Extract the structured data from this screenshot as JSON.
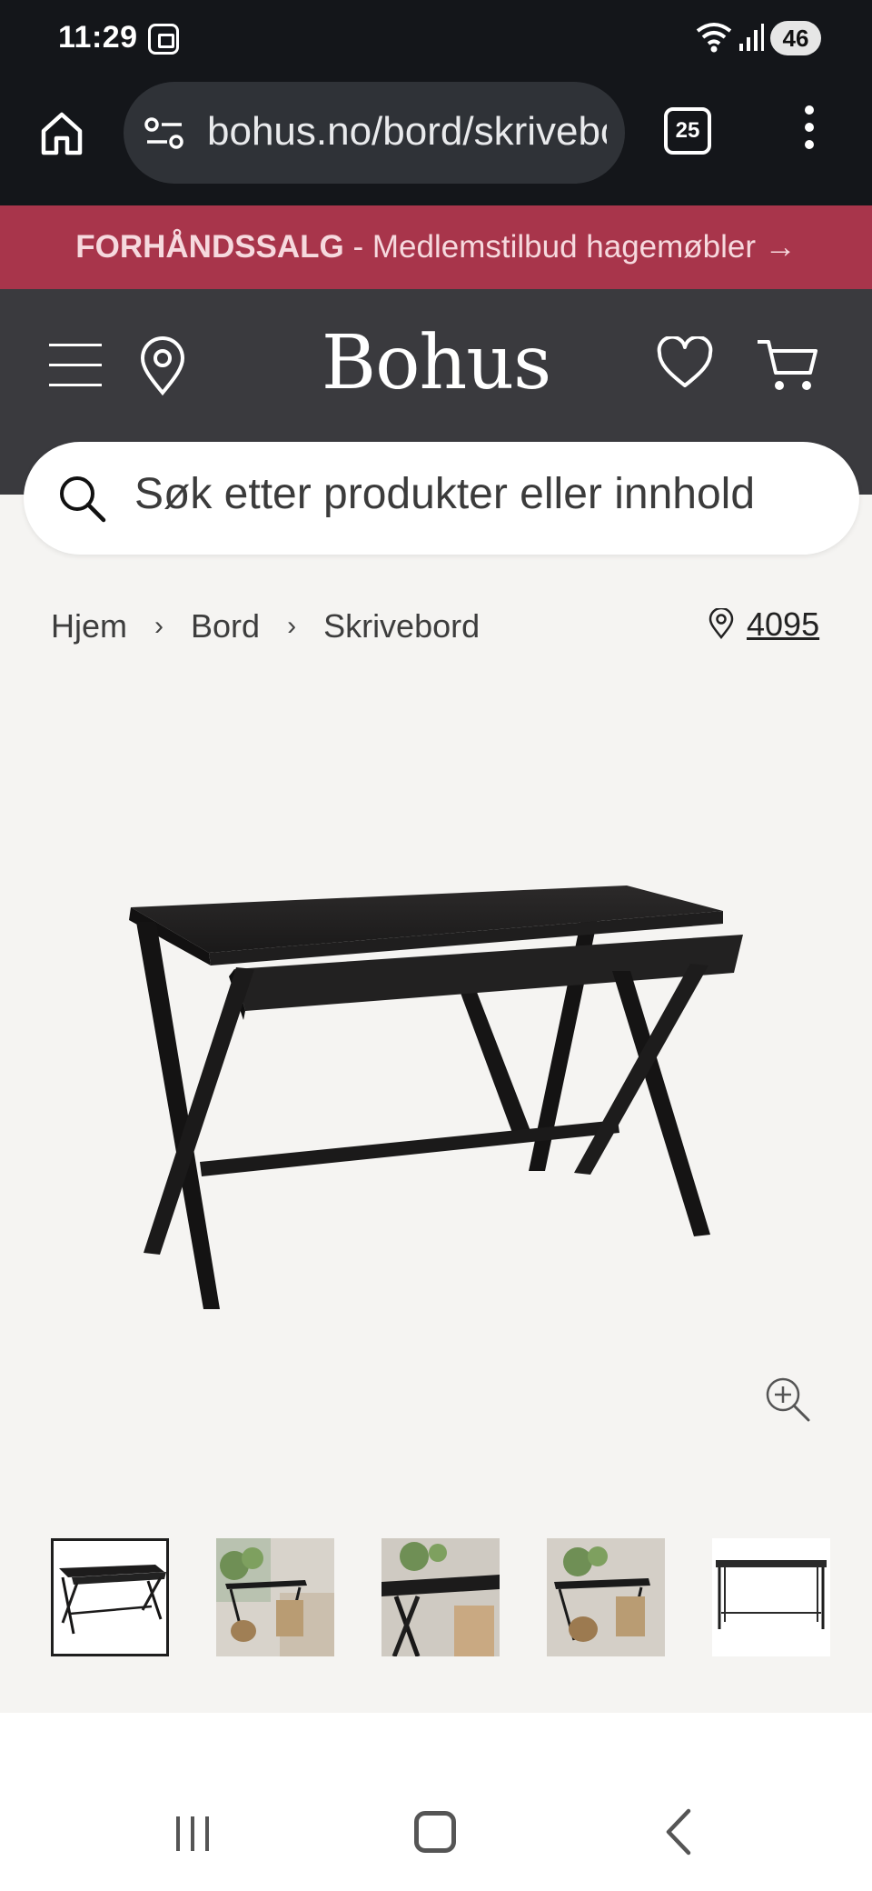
{
  "status_bar": {
    "time": "11:29",
    "battery": "46"
  },
  "browser": {
    "url": "bohus.no/bord/skrivebord",
    "tab_count": "25"
  },
  "promo": {
    "bold": "FORHÅNDSSALG",
    "rest": " - Medlemstilbud hagemøbler →"
  },
  "header": {
    "logo": "Bohus"
  },
  "search": {
    "placeholder": "Søk etter produkter eller innhold"
  },
  "breadcrumb": {
    "items": [
      "Hjem",
      "Bord",
      "Skrivebord"
    ],
    "sep": "›"
  },
  "store": {
    "postal_code": "4095"
  },
  "colors": {
    "promo_bg": "#a8354b",
    "header_bg": "#3a3a3e",
    "page_bg": "#f5f4f2"
  },
  "icons": {
    "home": "home-icon",
    "tune": "tune-icon",
    "tabs": "tabs-icon",
    "more": "more-vert-icon",
    "menu": "hamburger-icon",
    "location": "location-pin-icon",
    "wishlist": "heart-icon",
    "cart": "cart-icon",
    "search": "search-icon",
    "zoom": "zoom-in-icon"
  },
  "gallery": {
    "thumb_count": 5,
    "active_index": 0
  }
}
